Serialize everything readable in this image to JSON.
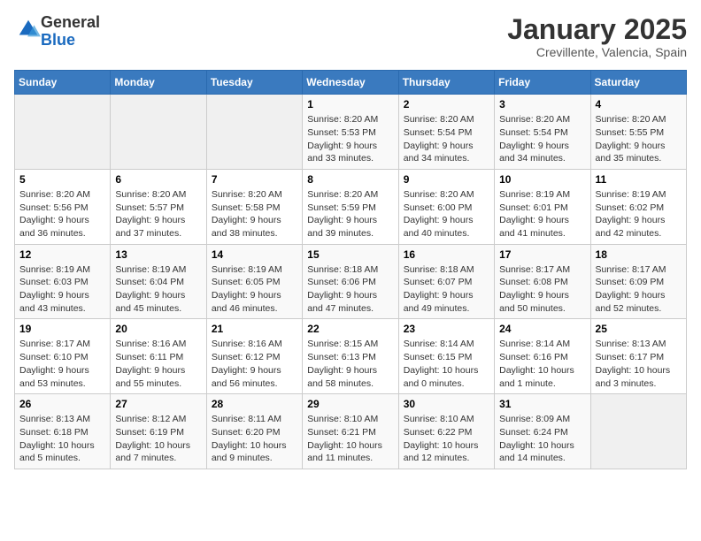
{
  "logo": {
    "general": "General",
    "blue": "Blue"
  },
  "header": {
    "month": "January 2025",
    "location": "Crevillente, Valencia, Spain"
  },
  "weekdays": [
    "Sunday",
    "Monday",
    "Tuesday",
    "Wednesday",
    "Thursday",
    "Friday",
    "Saturday"
  ],
  "weeks": [
    [
      {
        "day": "",
        "info": ""
      },
      {
        "day": "",
        "info": ""
      },
      {
        "day": "",
        "info": ""
      },
      {
        "day": "1",
        "info": "Sunrise: 8:20 AM\nSunset: 5:53 PM\nDaylight: 9 hours and 33 minutes."
      },
      {
        "day": "2",
        "info": "Sunrise: 8:20 AM\nSunset: 5:54 PM\nDaylight: 9 hours and 34 minutes."
      },
      {
        "day": "3",
        "info": "Sunrise: 8:20 AM\nSunset: 5:54 PM\nDaylight: 9 hours and 34 minutes."
      },
      {
        "day": "4",
        "info": "Sunrise: 8:20 AM\nSunset: 5:55 PM\nDaylight: 9 hours and 35 minutes."
      }
    ],
    [
      {
        "day": "5",
        "info": "Sunrise: 8:20 AM\nSunset: 5:56 PM\nDaylight: 9 hours and 36 minutes."
      },
      {
        "day": "6",
        "info": "Sunrise: 8:20 AM\nSunset: 5:57 PM\nDaylight: 9 hours and 37 minutes."
      },
      {
        "day": "7",
        "info": "Sunrise: 8:20 AM\nSunset: 5:58 PM\nDaylight: 9 hours and 38 minutes."
      },
      {
        "day": "8",
        "info": "Sunrise: 8:20 AM\nSunset: 5:59 PM\nDaylight: 9 hours and 39 minutes."
      },
      {
        "day": "9",
        "info": "Sunrise: 8:20 AM\nSunset: 6:00 PM\nDaylight: 9 hours and 40 minutes."
      },
      {
        "day": "10",
        "info": "Sunrise: 8:19 AM\nSunset: 6:01 PM\nDaylight: 9 hours and 41 minutes."
      },
      {
        "day": "11",
        "info": "Sunrise: 8:19 AM\nSunset: 6:02 PM\nDaylight: 9 hours and 42 minutes."
      }
    ],
    [
      {
        "day": "12",
        "info": "Sunrise: 8:19 AM\nSunset: 6:03 PM\nDaylight: 9 hours and 43 minutes."
      },
      {
        "day": "13",
        "info": "Sunrise: 8:19 AM\nSunset: 6:04 PM\nDaylight: 9 hours and 45 minutes."
      },
      {
        "day": "14",
        "info": "Sunrise: 8:19 AM\nSunset: 6:05 PM\nDaylight: 9 hours and 46 minutes."
      },
      {
        "day": "15",
        "info": "Sunrise: 8:18 AM\nSunset: 6:06 PM\nDaylight: 9 hours and 47 minutes."
      },
      {
        "day": "16",
        "info": "Sunrise: 8:18 AM\nSunset: 6:07 PM\nDaylight: 9 hours and 49 minutes."
      },
      {
        "day": "17",
        "info": "Sunrise: 8:17 AM\nSunset: 6:08 PM\nDaylight: 9 hours and 50 minutes."
      },
      {
        "day": "18",
        "info": "Sunrise: 8:17 AM\nSunset: 6:09 PM\nDaylight: 9 hours and 52 minutes."
      }
    ],
    [
      {
        "day": "19",
        "info": "Sunrise: 8:17 AM\nSunset: 6:10 PM\nDaylight: 9 hours and 53 minutes."
      },
      {
        "day": "20",
        "info": "Sunrise: 8:16 AM\nSunset: 6:11 PM\nDaylight: 9 hours and 55 minutes."
      },
      {
        "day": "21",
        "info": "Sunrise: 8:16 AM\nSunset: 6:12 PM\nDaylight: 9 hours and 56 minutes."
      },
      {
        "day": "22",
        "info": "Sunrise: 8:15 AM\nSunset: 6:13 PM\nDaylight: 9 hours and 58 minutes."
      },
      {
        "day": "23",
        "info": "Sunrise: 8:14 AM\nSunset: 6:15 PM\nDaylight: 10 hours and 0 minutes."
      },
      {
        "day": "24",
        "info": "Sunrise: 8:14 AM\nSunset: 6:16 PM\nDaylight: 10 hours and 1 minute."
      },
      {
        "day": "25",
        "info": "Sunrise: 8:13 AM\nSunset: 6:17 PM\nDaylight: 10 hours and 3 minutes."
      }
    ],
    [
      {
        "day": "26",
        "info": "Sunrise: 8:13 AM\nSunset: 6:18 PM\nDaylight: 10 hours and 5 minutes."
      },
      {
        "day": "27",
        "info": "Sunrise: 8:12 AM\nSunset: 6:19 PM\nDaylight: 10 hours and 7 minutes."
      },
      {
        "day": "28",
        "info": "Sunrise: 8:11 AM\nSunset: 6:20 PM\nDaylight: 10 hours and 9 minutes."
      },
      {
        "day": "29",
        "info": "Sunrise: 8:10 AM\nSunset: 6:21 PM\nDaylight: 10 hours and 11 minutes."
      },
      {
        "day": "30",
        "info": "Sunrise: 8:10 AM\nSunset: 6:22 PM\nDaylight: 10 hours and 12 minutes."
      },
      {
        "day": "31",
        "info": "Sunrise: 8:09 AM\nSunset: 6:24 PM\nDaylight: 10 hours and 14 minutes."
      },
      {
        "day": "",
        "info": ""
      }
    ]
  ]
}
